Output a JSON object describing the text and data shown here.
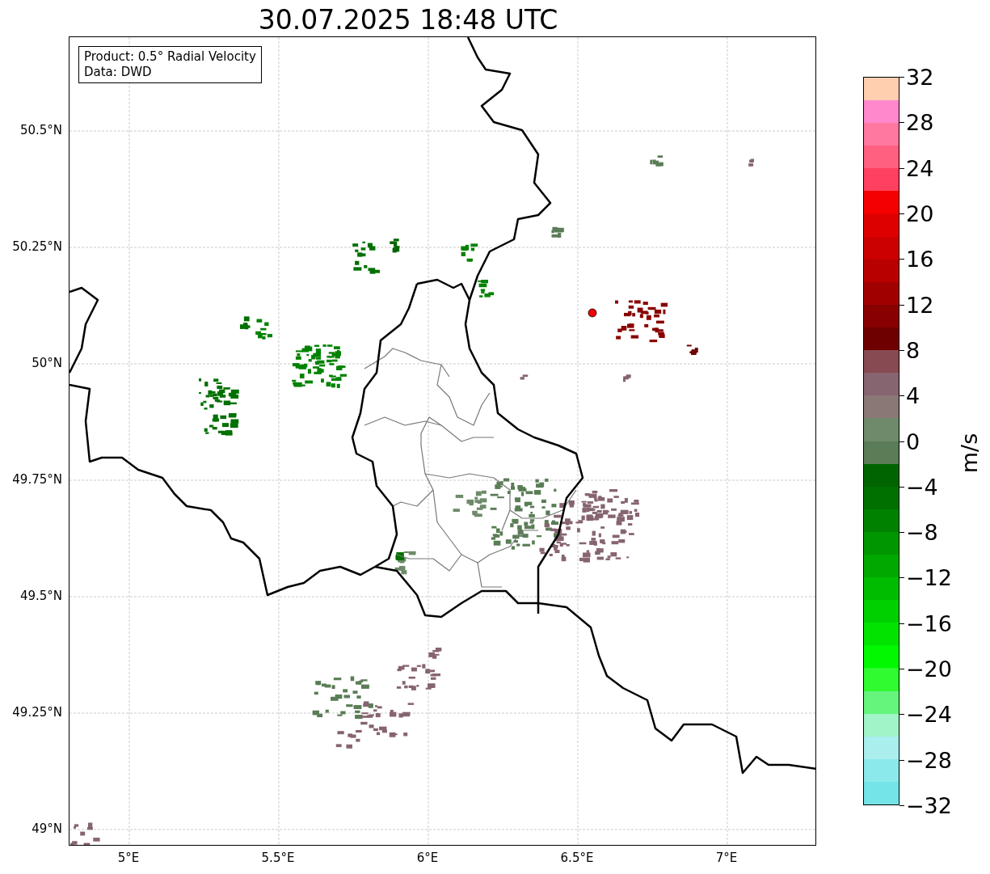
{
  "title": "30.07.2025 18:48 UTC",
  "info_box": [
    "Product: 0.5° Radial Velocity",
    "Data: DWD"
  ],
  "x_ticks": [
    "5°E",
    "5.5°E",
    "6°E",
    "6.5°E",
    "7°E"
  ],
  "y_ticks": [
    "50.5°N",
    "50.25°N",
    "50°N",
    "49.75°N",
    "49.5°N",
    "49.25°N",
    "49°N"
  ],
  "colorbar": {
    "label": "m/s",
    "ticks": [
      "32",
      "28",
      "24",
      "20",
      "16",
      "12",
      "8",
      "4",
      "0",
      "−4",
      "−8",
      "−12",
      "−16",
      "−20",
      "−24",
      "−28",
      "−32"
    ],
    "bands": [
      {
        "color": "#74e4e8"
      },
      {
        "color": "#8ce9eb"
      },
      {
        "color": "#aaeeee"
      },
      {
        "color": "#a0f4c8"
      },
      {
        "color": "#66f57c"
      },
      {
        "color": "#30fa30"
      },
      {
        "color": "#00f800"
      },
      {
        "color": "#00e400"
      },
      {
        "color": "#00d000"
      },
      {
        "color": "#00bc00"
      },
      {
        "color": "#00a800"
      },
      {
        "color": "#009600"
      },
      {
        "color": "#008200"
      },
      {
        "color": "#007000"
      },
      {
        "color": "#006400"
      },
      {
        "color": "#5a7c56"
      },
      {
        "color": "#6e8a6a"
      },
      {
        "color": "#8a7876"
      },
      {
        "color": "#866470"
      },
      {
        "color": "#884a52"
      },
      {
        "color": "#6e0000"
      },
      {
        "color": "#880000"
      },
      {
        "color": "#a00000"
      },
      {
        "color": "#b80000"
      },
      {
        "color": "#cc0000"
      },
      {
        "color": "#de0000"
      },
      {
        "color": "#f40000"
      },
      {
        "color": "#ff4060"
      },
      {
        "color": "#ff6080"
      },
      {
        "color": "#ff78a0"
      },
      {
        "color": "#ff88cc"
      },
      {
        "color": "#ffcfb0"
      }
    ]
  }
}
